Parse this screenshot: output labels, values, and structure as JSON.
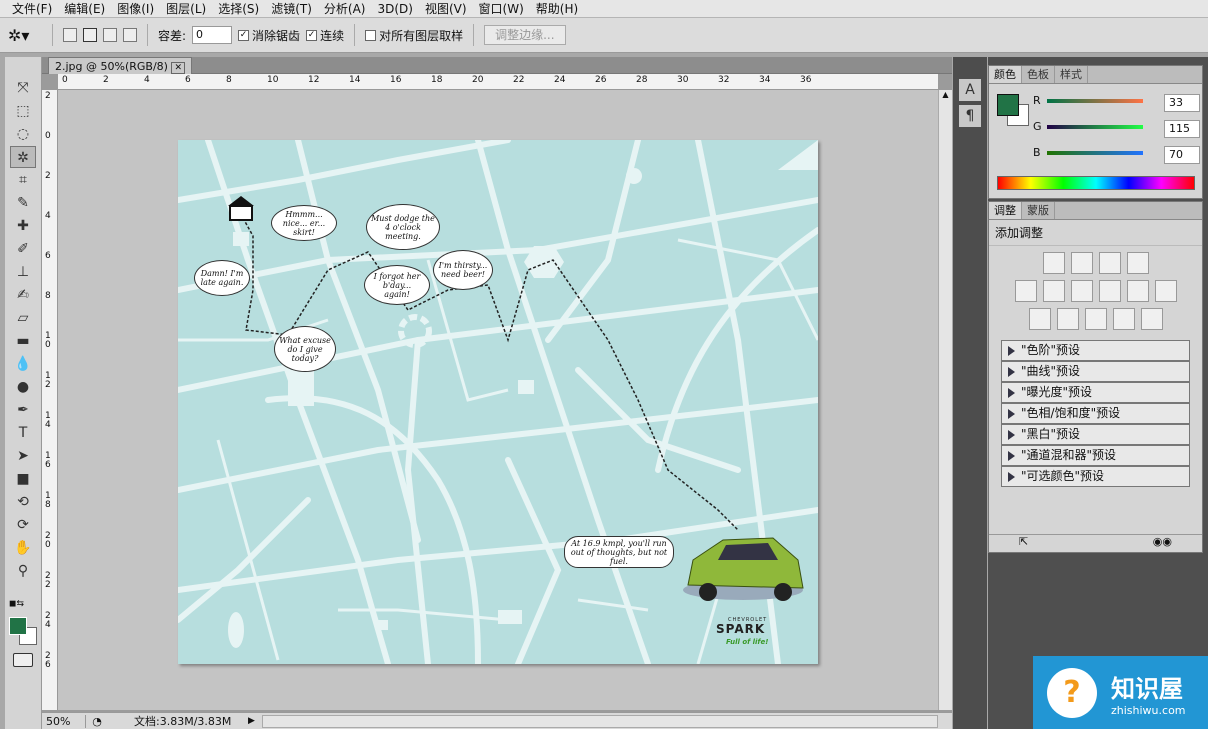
{
  "menu": [
    "文件(F)",
    "编辑(E)",
    "图像(I)",
    "图层(L)",
    "选择(S)",
    "滤镜(T)",
    "分析(A)",
    "3D(D)",
    "视图(V)",
    "窗口(W)",
    "帮助(H)"
  ],
  "options": {
    "tolerance_label": "容差:",
    "tolerance_value": "0",
    "antialias_label": "消除锯齿",
    "contiguous_label": "连续",
    "sample_all_label": "对所有图层取样",
    "refine_edge_label": "调整边缘..."
  },
  "document": {
    "tab_title": "2.jpg @ 50%(RGB/8)",
    "zoom": "50%",
    "doc_size": "文档:3.83M/3.83M",
    "ruler_top": [
      "0",
      "2",
      "4",
      "6",
      "8",
      "10",
      "12",
      "14",
      "16",
      "18",
      "20",
      "22",
      "24",
      "26",
      "28",
      "30",
      "32",
      "34",
      "36"
    ],
    "ruler_left": [
      "2",
      "0",
      "2",
      "4",
      "6",
      "8",
      "1\n0",
      "1\n2",
      "1\n4",
      "1\n6",
      "1\n8",
      "2\n0",
      "2\n2",
      "2\n4",
      "2\n6"
    ]
  },
  "artwork": {
    "bubbles": [
      "Hmmm... nice... er... skirt!",
      "Must dodge the 4 o'clock meeting.",
      "Damn! I'm late again.",
      "I forgot her b'day... again!",
      "I'm thirsty... need beer!",
      "What excuse do I give today?",
      "At 16.9 kmpl, you'll run out of thoughts, but not fuel."
    ],
    "brand_small": "CHEVROLET",
    "brand": "SPARK",
    "tagline": "Full of life!"
  },
  "color_panel": {
    "tabs": [
      "颜色",
      "色板",
      "样式"
    ],
    "r_label": "R",
    "g_label": "G",
    "b_label": "B",
    "r": 33,
    "g": 115,
    "b": 70,
    "fg_color": "#217346"
  },
  "adjust_panel": {
    "tabs": [
      "调整",
      "蒙版"
    ],
    "title": "添加调整",
    "presets": [
      "\"色阶\"预设",
      "\"曲线\"预设",
      "\"曝光度\"预设",
      "\"色相/饱和度\"预设",
      "\"黑白\"预设",
      "\"通道混和器\"预设",
      "\"可选颜色\"预设"
    ]
  },
  "watermark": {
    "name": "知识屋",
    "url": "zhishiwu.com"
  }
}
